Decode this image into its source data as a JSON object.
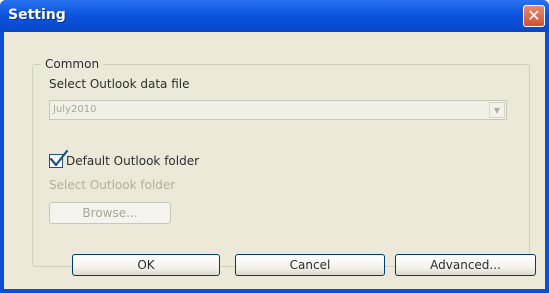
{
  "window": {
    "title": "Setting",
    "close_icon": "close-icon"
  },
  "group": {
    "legend": "Common",
    "data_file_label": "Select Outlook data file",
    "data_file_value": "July2010",
    "default_folder_label": "Default Outlook folder",
    "default_folder_checked": true,
    "select_folder_label": "Select Outlook folder",
    "browse_label": "Browse..."
  },
  "buttons": {
    "ok": "OK",
    "cancel": "Cancel",
    "advanced": "Advanced..."
  },
  "colors": {
    "titlebar": "#0c55de",
    "dialog_bg": "#ece9d8",
    "close": "#d0512e"
  }
}
